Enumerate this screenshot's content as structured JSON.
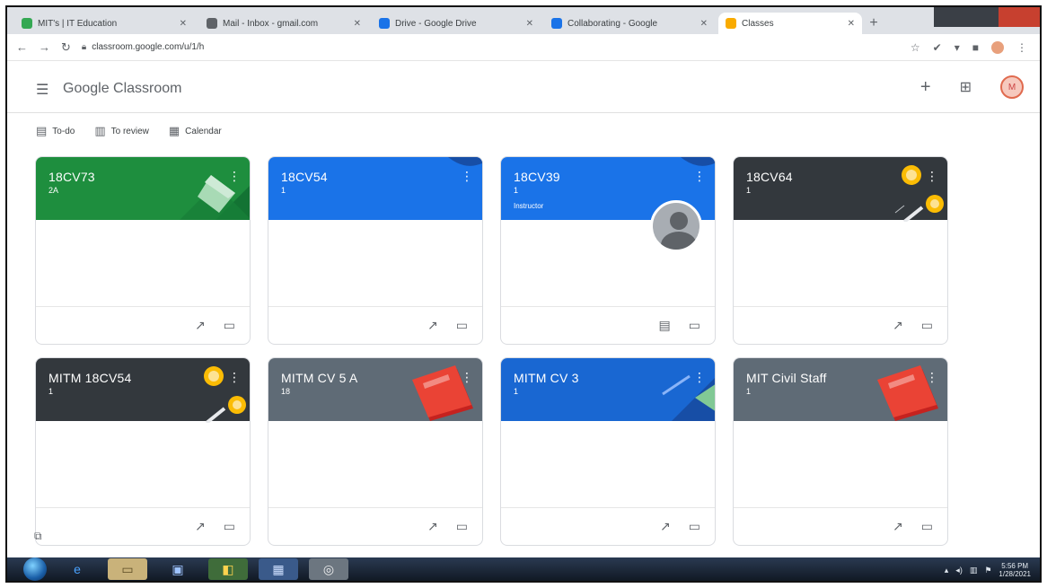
{
  "browser": {
    "tabs": [
      {
        "label": "MIT's | IT Education",
        "color": "#34a853"
      },
      {
        "label": "Mail - Inbox - gmail.com",
        "color": "#5f6368"
      },
      {
        "label": "Drive - Google Drive",
        "color": "#1a73e8"
      },
      {
        "label": "Collaborating - Google",
        "color": "#1a73e8"
      },
      {
        "label": "Classes",
        "color": "#f9ab00"
      }
    ],
    "new_tab": "+",
    "url": "classroom.google.com/u/1/h",
    "back_icon": "arrow-left-icon",
    "forward_icon": "arrow-right-icon",
    "reload_icon": "reload-icon"
  },
  "app": {
    "brand": "Google Classroom",
    "menu_glyph": "☰",
    "add_glyph": "+",
    "apps_glyph": "⊞",
    "avatar_initial": "M",
    "avatar_color": "#e06a4e"
  },
  "subnav": [
    {
      "icon": "▤",
      "label": "To-do"
    },
    {
      "icon": "▥",
      "label": "To review"
    },
    {
      "icon": "▦",
      "label": "Calendar"
    }
  ],
  "classes": [
    {
      "title": "18CV73",
      "sub": "2A",
      "owner": "",
      "color": "#1e8e3e",
      "theme": "geometry-green"
    },
    {
      "title": "18CV54",
      "sub": "1",
      "owner": "",
      "color": "#1a73e8",
      "theme": "blue-wave"
    },
    {
      "title": "18CV39",
      "sub": "1",
      "owner": "Instructor",
      "color": "#1a73e8",
      "theme": "blue-photo"
    },
    {
      "title": "18CV64",
      "sub": "1",
      "owner": "",
      "color": "#33383d",
      "theme": "dark-bulb"
    },
    {
      "title": "MITM 18CV54",
      "sub": "1",
      "owner": "",
      "color": "#33383d",
      "theme": "dark-bulb"
    },
    {
      "title": "MITM CV 5 A",
      "sub": "18",
      "owner": "",
      "color": "#5f6b76",
      "theme": "books"
    },
    {
      "title": "MITM CV 3",
      "sub": "1",
      "owner": "",
      "color": "#1967d2",
      "theme": "blue-geo"
    },
    {
      "title": "MIT Civil Staff",
      "sub": "1",
      "owner": "",
      "color": "#5f6b76",
      "theme": "books"
    }
  ],
  "card_icons": {
    "trend": "↗",
    "folder": "▭"
  },
  "taskbar": {
    "apps": [
      "e",
      "▭",
      "▣",
      "◧",
      "▦",
      "◎"
    ],
    "clock_time": "5:56 PM",
    "clock_date": "1/28/2021"
  }
}
